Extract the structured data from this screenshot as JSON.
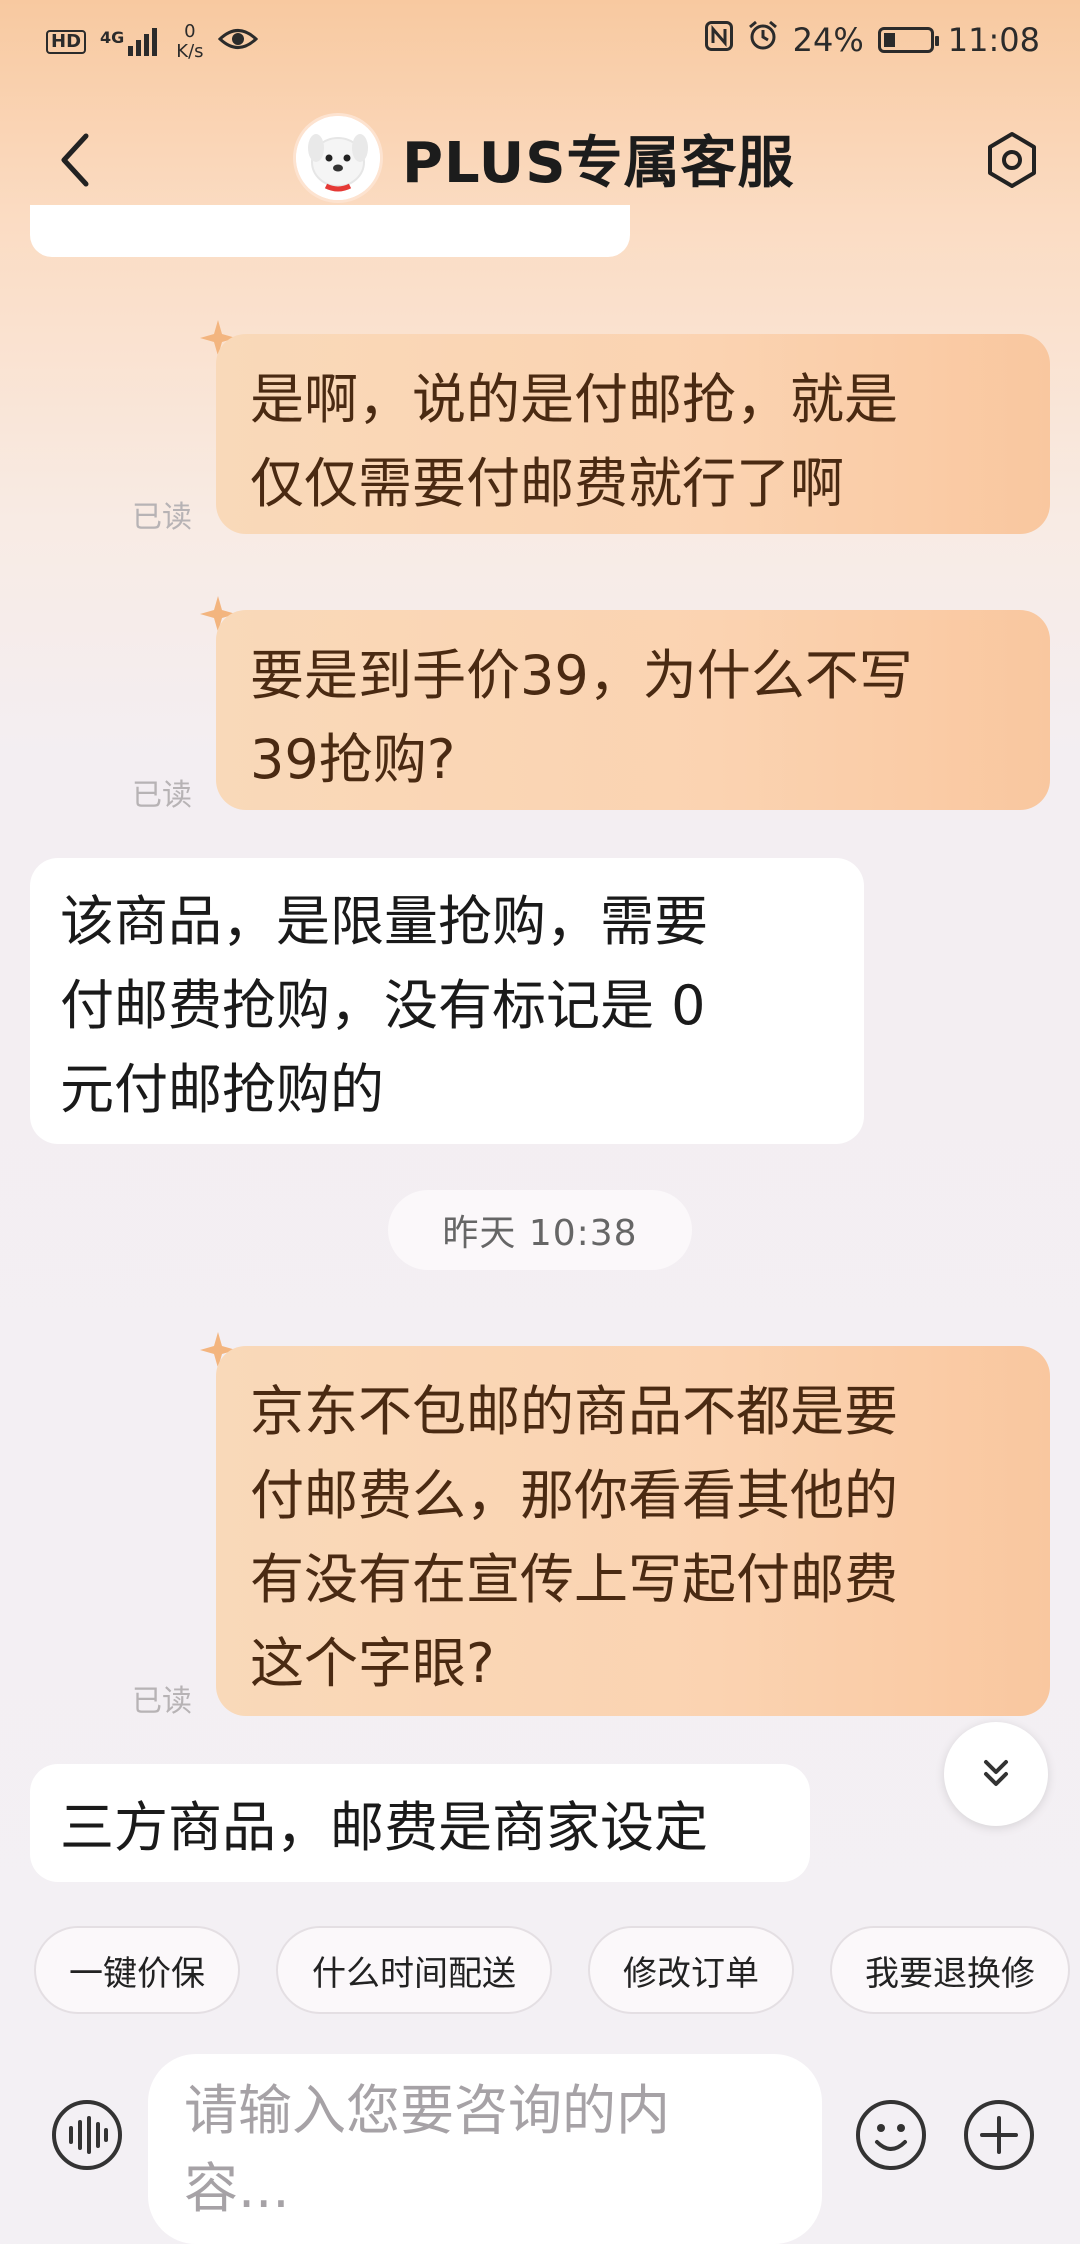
{
  "status_bar": {
    "hd": "HD",
    "network_gen": "4G",
    "speed_value": "0",
    "speed_unit": "K/s",
    "battery": "24%",
    "battery_level": 0.24,
    "time": "11:08"
  },
  "header": {
    "title": "PLUS专属客服"
  },
  "messages": [
    {
      "side": "right",
      "lines": [
        "是啊，说的是付邮抢，就是",
        "仅仅需要付邮费就行了啊"
      ],
      "status": "已读"
    },
    {
      "side": "right",
      "lines": [
        "要是到手价39，为什么不写",
        "39抢购?"
      ],
      "status": "已读"
    },
    {
      "side": "left",
      "lines": [
        "该商品，是限量抢购，需要",
        "付邮费抢购，没有标记是  0",
        "元付邮抢购的"
      ]
    },
    {
      "side": "right",
      "lines": [
        "京东不包邮的商品不都是要",
        "付邮费么，那你看看其他的",
        "有没有在宣传上写起付邮费",
        "这个字眼?"
      ],
      "status": "已读"
    },
    {
      "side": "left",
      "lines": [
        "三方商品，邮费是商家设定"
      ]
    }
  ],
  "time_divider": "昨天  10:38",
  "quick_replies": [
    "一键价保",
    "什么时间配送",
    "修改订单",
    "我要退换修"
  ],
  "input": {
    "placeholder_lines": [
      "请输入您要咨询的内",
      "容..."
    ]
  },
  "icons": {
    "back": "back-arrow-icon",
    "settings": "settings-hexagon-icon",
    "voice": "voice-wave-icon",
    "emoji": "emoji-icon",
    "plus": "plus-icon",
    "scroll": "double-chevron-down-icon"
  },
  "colors": {
    "user_bubble": "#f9d2ae",
    "user_text": "#4a2a12",
    "agent_bubble": "#ffffff",
    "accent_star": "#f2b27a"
  }
}
